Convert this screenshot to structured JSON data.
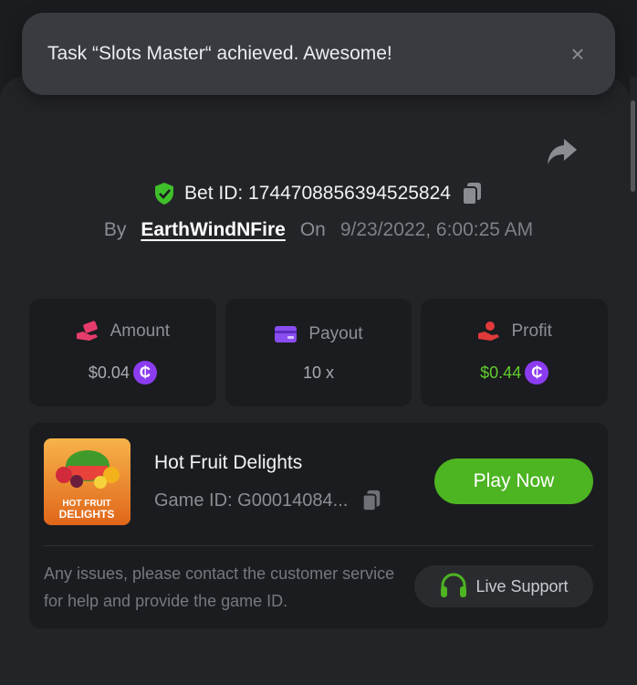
{
  "toast": {
    "message": "Task “Slots Master“ achieved. Awesome!",
    "close_icon": "×"
  },
  "bet": {
    "id_label": "Bet ID: 1744708856394525824",
    "by_label": "By",
    "username": "EarthWindNFire",
    "on_label": "On",
    "date": "9/23/2022, 6:00:25 AM"
  },
  "stats": [
    {
      "label": "Amount",
      "value": "$0.04",
      "icon": "hand-money-icon",
      "coin": "₵"
    },
    {
      "label": "Payout",
      "value": "10 x",
      "icon": "card-icon"
    },
    {
      "label": "Profit",
      "value": "$0.44",
      "icon": "hand-coin-icon",
      "coin": "₵"
    }
  ],
  "game": {
    "title": "Hot Fruit Delights",
    "game_id": "Game ID: G00014084...",
    "play_label": "Play Now",
    "thumb_text_top": "HOT FRUIT",
    "thumb_text_bottom": "DELIGHTS"
  },
  "support": {
    "help_text": "Any issues, please contact the customer service for help and provide the game ID.",
    "button_label": "Live Support"
  },
  "colors": {
    "accent_green": "#4db422",
    "profit_green": "#5fce2c",
    "coin_purple": "#8b3cf0",
    "amount_icon": "#e63c6c",
    "payout_icon": "#8a4df0",
    "profit_icon": "#e23a3a"
  }
}
